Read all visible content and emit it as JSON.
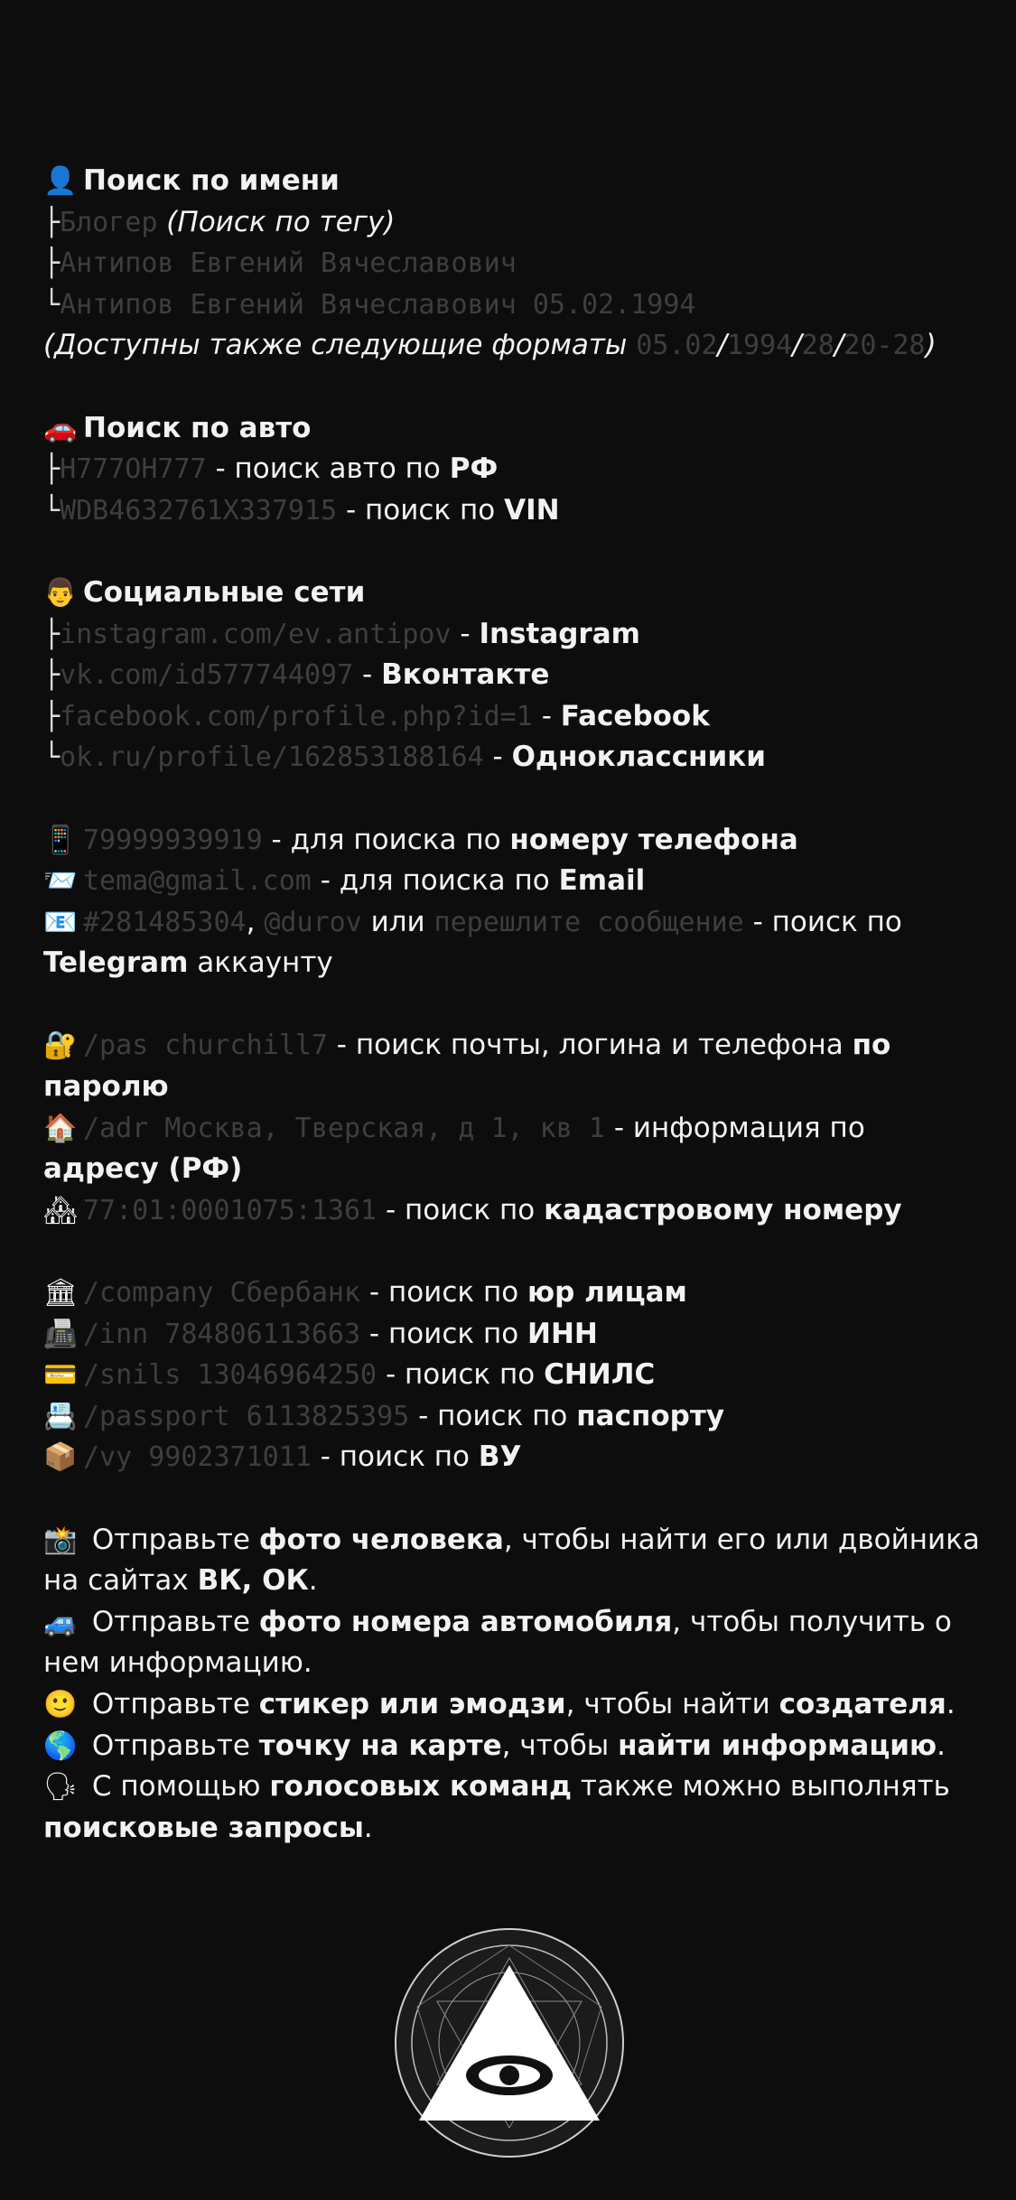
{
  "name_section": {
    "icon": "👤",
    "icon_name": "user-silhouette-icon",
    "title": "Поиск по имени",
    "b1": "├",
    "b2": "├",
    "b3": "└",
    "item1_code": "Блогер",
    "item1_note": "(Поиск по тегу)",
    "item2_code": "Антипов Евгений Вячеславович",
    "item3_code": "Антипов Евгений Вячеславович 05.02.1994",
    "formats_prefix": "(Доступны также следующие форматы ",
    "fmt1": "05.02",
    "sep1": "/",
    "fmt2": "1994",
    "sep2": "/",
    "fmt3": "28",
    "sep3": "/",
    "fmt4": "20-28",
    "formats_suffix": ")"
  },
  "auto_section": {
    "icon": "🚗",
    "icon_name": "car-icon",
    "title": "Поиск по авто",
    "b1": "├",
    "b2": "└",
    "item1_code": "Н777ОН777",
    "item1_text": " - поиск авто по ",
    "item1_bold": "РФ",
    "item2_code": "WDB4632761X337915",
    "item2_text": " - поиск по ",
    "item2_bold": "VIN"
  },
  "social_section": {
    "icon": "👨",
    "icon_name": "man-face-icon",
    "title": "Социальные сети",
    "b1": "├",
    "b2": "├",
    "b3": "├",
    "b4": "└",
    "dash": " - ",
    "item1_code": "instagram.com/ev.antipov",
    "item1_bold": "Instagram",
    "item2_code": "vk.com/id577744097",
    "item2_bold": "Вконтакте",
    "item3_code": "facebook.com/profile.php?id=1",
    "item3_bold": "Facebook",
    "item4_code": "ok.ru/profile/162853188164",
    "item4_bold": "Одноклассники"
  },
  "contact_section": {
    "phone_icon": "📱",
    "phone_code": "79999939919",
    "phone_text": " - для поиска по ",
    "phone_bold": "номеру телефона",
    "email_icon": "📨",
    "email_code": "tema@gmail.com",
    "email_text": " - для поиска по ",
    "email_bold": "Email",
    "tg_icon": "📧",
    "tg_code1": "#281485304",
    "tg_comma": ", ",
    "tg_code2": "@durov",
    "tg_or": " или ",
    "tg_code3": "перешлите сообщение",
    "tg_text": " - поиск по ",
    "tg_bold": "Telegram",
    "tg_tail": " аккаунту"
  },
  "lookup_section": {
    "pas_icon": "🔐",
    "pas_code": "/pas churchill7",
    "pas_text": " - поиск почты, логина и телефона ",
    "pas_bold": "по паролю",
    "adr_icon": "🏠",
    "adr_code": "/adr Москва, Тверская, д 1, кв 1",
    "adr_text": " - информация по ",
    "adr_bold": "адресу (РФ)",
    "kad_icon": "🏘",
    "kad_code": "77:01:0001075:1361",
    "kad_text": " - поиск по ",
    "kad_bold": "кадастровому номеру"
  },
  "docs_section": {
    "comp_icon": "🏛",
    "comp_code": "/company Сбербанк",
    "comp_text": " - поиск по ",
    "comp_bold": "юр лицам",
    "inn_icon": "📠",
    "inn_code": "/inn 784806113663",
    "inn_text": " - поиск по ",
    "inn_bold": "ИНН",
    "snils_icon": "💳",
    "snils_code": "/snils 13046964250",
    "snils_text": " - поиск по ",
    "snils_bold": "СНИЛС",
    "pass_icon": "📇",
    "pass_code": "/passport 6113825395",
    "pass_text": " - поиск по ",
    "pass_bold": "паспорту",
    "vy_icon": "📦",
    "vy_code": "/vy 9902371011",
    "vy_text": " - поиск по ",
    "vy_bold": "ВУ"
  },
  "media_section": {
    "photo_icon": "📸",
    "photo_pre": " Отправьте ",
    "photo_bold": "фото человека",
    "photo_mid": ", чтобы найти его или двойника на сайтах ",
    "photo_bold2": "ВК, ОК",
    "photo_end": ".",
    "plate_icon": "🚙",
    "plate_pre": " Отправьте ",
    "plate_bold": "фото номера автомобиля",
    "plate_mid": ", чтобы получить о нем информацию.",
    "sticker_icon": "🙂",
    "sticker_pre": " Отправьте ",
    "sticker_bold": "стикер или эмодзи",
    "sticker_mid": ", чтобы найти ",
    "sticker_bold2": "создателя",
    "sticker_end": ".",
    "map_icon": "🌎",
    "map_pre": " Отправьте ",
    "map_bold": "точку на карте",
    "map_mid": ", чтобы ",
    "map_bold2": "найти информацию",
    "map_end": ".",
    "voice_icon": "🗣",
    "voice_pre": " С помощью ",
    "voice_bold": "голосовых команд",
    "voice_mid": " также можно выполнять ",
    "voice_bold2": "поисковые запросы",
    "voice_end": "."
  },
  "colors": {
    "background": "#0d0d0d",
    "text": "#f2f2f2",
    "code": "#3e3e3e"
  }
}
